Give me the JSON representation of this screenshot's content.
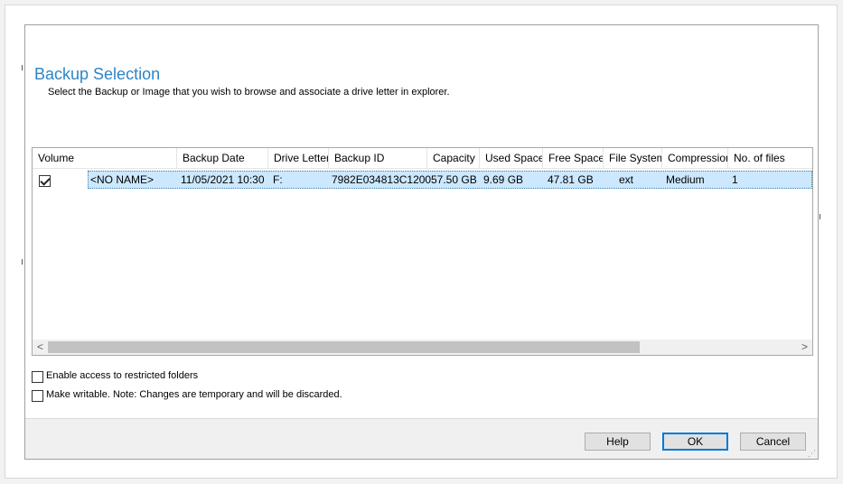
{
  "dialog": {
    "title": "Backup Selection",
    "subtitle": "Select the Backup or Image that you wish to browse and associate a drive letter in explorer."
  },
  "table": {
    "columns": [
      "Volume",
      "Backup Date",
      "Drive Letter",
      "Backup ID",
      "Capacity",
      "Used Space",
      "Free Space",
      "File System",
      "Compression",
      "No. of files"
    ],
    "rows": [
      {
        "checked": true,
        "name": "<NO NAME>",
        "backup_date": "11/05/2021 10:30",
        "drive_letter": "F:",
        "backup_id": "7982E034813C1200",
        "capacity": "57.50 GB",
        "used_space": "9.69 GB",
        "free_space": "47.81 GB",
        "file_system": "ext",
        "compression": "Medium",
        "no_of_files": "1"
      }
    ]
  },
  "scrollbar": {
    "left_arrow": "<",
    "right_arrow": ">"
  },
  "options": {
    "restricted": {
      "label": "Enable access to restricted folders",
      "checked": false
    },
    "writable": {
      "label": "Make writable. Note: Changes are temporary and will be discarded.",
      "checked": false
    }
  },
  "buttons": {
    "help": "Help",
    "ok": "OK",
    "cancel": "Cancel"
  },
  "colors": {
    "title": "#2c85c8",
    "selection": "#cce8ff",
    "default_button_border": "#0078d7"
  }
}
